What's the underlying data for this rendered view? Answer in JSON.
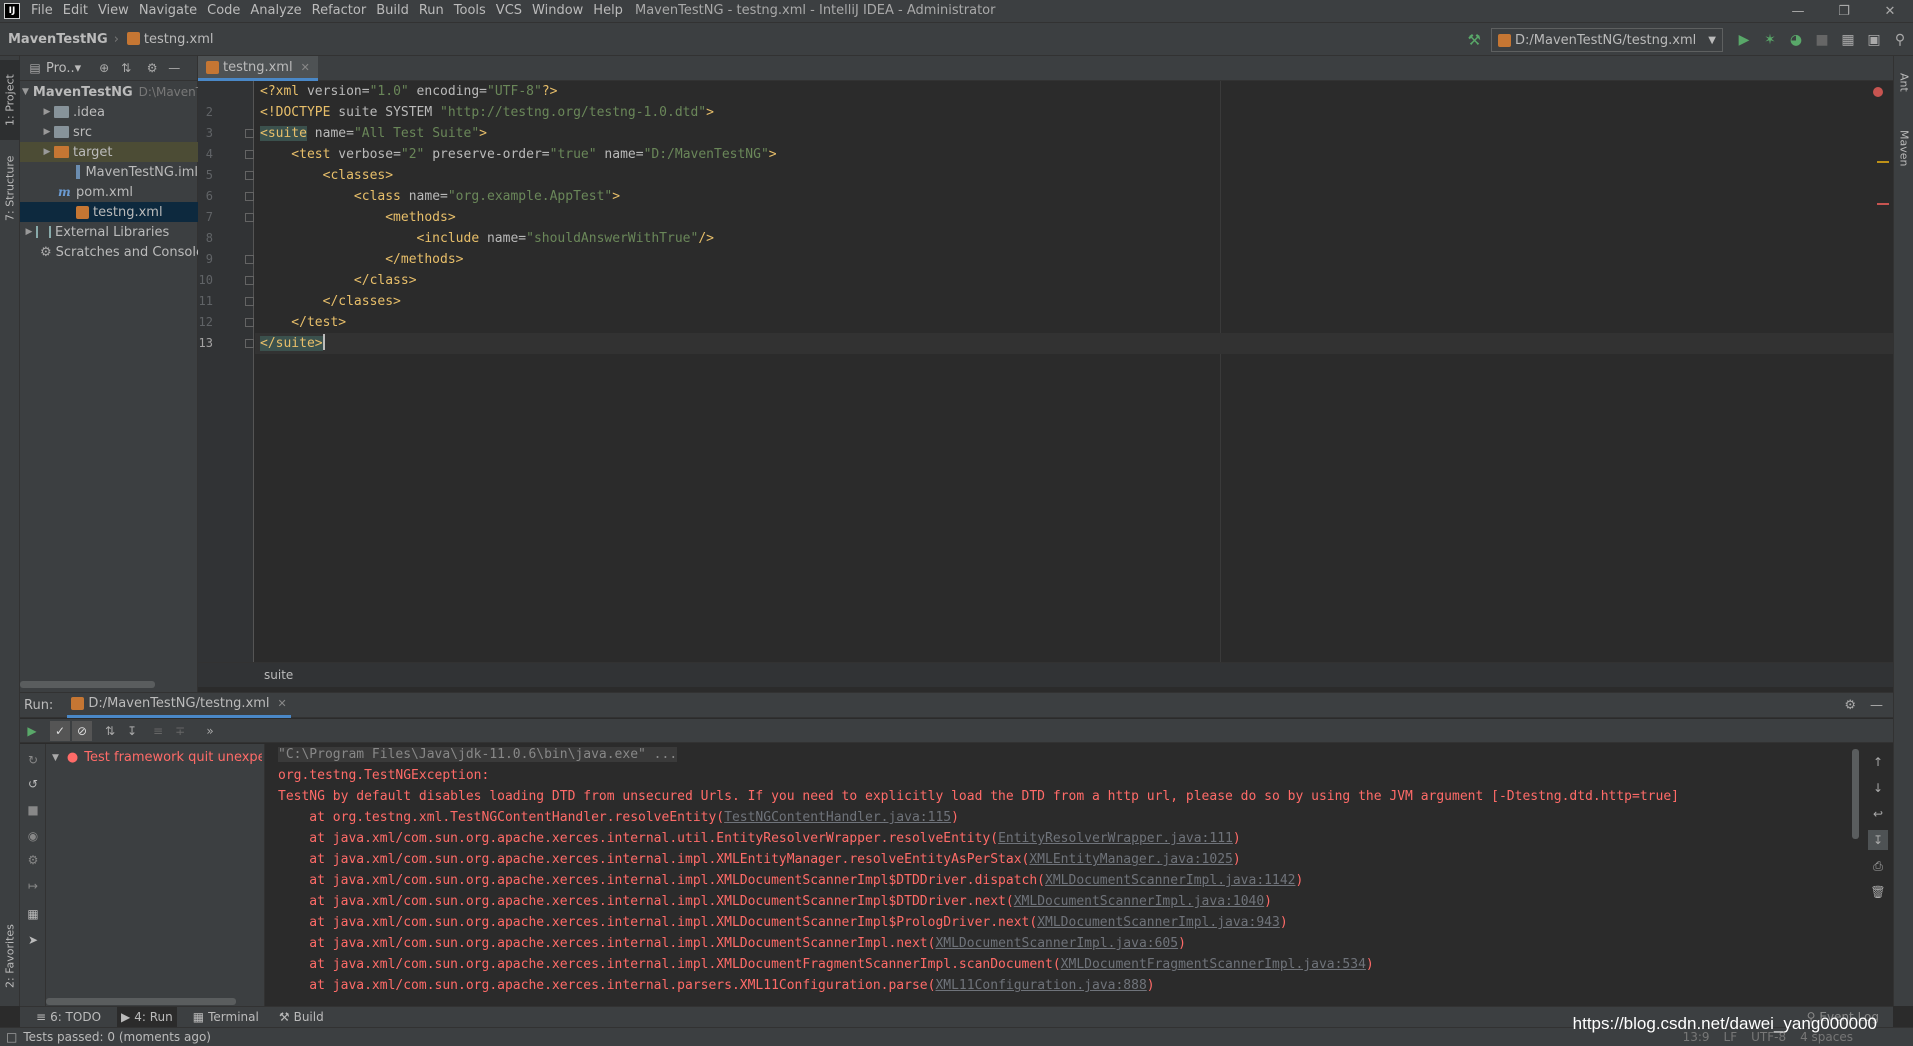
{
  "menubar": {
    "logo": "IJ",
    "items": [
      "File",
      "Edit",
      "View",
      "Navigate",
      "Code",
      "Analyze",
      "Refactor",
      "Build",
      "Run",
      "Tools",
      "VCS",
      "Window",
      "Help"
    ],
    "window_title": "MavenTestNG - testng.xml - IntelliJ IDEA - Administrator"
  },
  "navbar": {
    "project": "MavenTestNG",
    "file": "testng.xml",
    "run_config": "D:/MavenTestNG/testng.xml"
  },
  "left_stripe": {
    "project_tab": "1: Project",
    "structure_tab": "7: Structure",
    "favorites_tab": "2: Favorites"
  },
  "right_stripe": {
    "ant_tab": "Ant",
    "maven_tab": "Maven"
  },
  "project_panel": {
    "title": "Pro..▾",
    "tree": [
      {
        "label": "MavenTestNG",
        "hint": "D:\\MavenTestNG"
      },
      {
        "label": ".idea"
      },
      {
        "label": "src"
      },
      {
        "label": "target"
      },
      {
        "label": "MavenTestNG.iml"
      },
      {
        "label": "pom.xml"
      },
      {
        "label": "testng.xml"
      },
      {
        "label": "External Libraries"
      },
      {
        "label": "Scratches and Consoles"
      }
    ]
  },
  "editor": {
    "tab": "testng.xml",
    "breadcrumb": "suite",
    "line_numbers": [
      "2",
      "3",
      "4",
      "5",
      "6",
      "7",
      "8",
      "9",
      "10",
      "11",
      "12",
      "13"
    ],
    "lines": [
      {
        "tag": "<?xml",
        "a1": " version=",
        "v1": "\"1.0\"",
        "a2": " encoding=",
        "v2": "\"UTF-8\"",
        "end": "?>"
      },
      {
        "tag": "<!DOCTYPE",
        "a1": " suite SYSTEM ",
        "v1": "\"http://testng.org/testng-1.0.dtd\"",
        "end": ">"
      },
      {
        "tag": "suite",
        "a1": " name=",
        "v1": "\"All Test Suite\"",
        "end": ">"
      },
      {
        "tag": "    <test",
        "a1": " verbose=",
        "v1": "\"2\"",
        "a2": " preserve-order=",
        "v2": "\"true\"",
        "a3": " name=",
        "v3": "\"D:/MavenTestNG\"",
        "end": ">"
      },
      {
        "tag": "        <classes>"
      },
      {
        "tag": "            <class",
        "a1": " name=",
        "v1": "\"org.example.AppTest\"",
        "end": ">"
      },
      {
        "tag": "                <methods>"
      },
      {
        "tag": "                    <include",
        "a1": " name=",
        "v1": "\"shouldAnswerWithTrue\"",
        "end": "/>"
      },
      {
        "tag": "                </methods>"
      },
      {
        "tag": "            </class>"
      },
      {
        "tag": "        </classes>"
      },
      {
        "tag": "    </test>"
      },
      {
        "tag": "/suite"
      }
    ]
  },
  "run_panel": {
    "label": "Run:",
    "tab": "D:/MavenTestNG/testng.xml",
    "test_result": "Test framework quit unexpect",
    "console": {
      "cmd": "\"C:\\Program Files\\Java\\jdk-11.0.6\\bin\\java.exe\" ...",
      "exception": "org.testng.TestNGException:",
      "message": "TestNG by default disables loading DTD from unsecured Urls. If you need to explicitly load the DTD from a http url, please do so by using the JVM argument [-Dtestng.dtd.http=true]",
      "stack": [
        {
          "at": "    at org.testng.xml.TestNGContentHandler.resolveEntity(",
          "link": "TestNGContentHandler.java:115",
          "end": ")"
        },
        {
          "at": "    at java.xml/com.sun.org.apache.xerces.internal.util.EntityResolverWrapper.resolveEntity(",
          "link": "EntityResolverWrapper.java:111",
          "end": ")"
        },
        {
          "at": "    at java.xml/com.sun.org.apache.xerces.internal.impl.XMLEntityManager.resolveEntityAsPerStax(",
          "link": "XMLEntityManager.java:1025",
          "end": ")"
        },
        {
          "at": "    at java.xml/com.sun.org.apache.xerces.internal.impl.XMLDocumentScannerImpl$DTDDriver.dispatch(",
          "link": "XMLDocumentScannerImpl.java:1142",
          "end": ")"
        },
        {
          "at": "    at java.xml/com.sun.org.apache.xerces.internal.impl.XMLDocumentScannerImpl$DTDDriver.next(",
          "link": "XMLDocumentScannerImpl.java:1040",
          "end": ")"
        },
        {
          "at": "    at java.xml/com.sun.org.apache.xerces.internal.impl.XMLDocumentScannerImpl$PrologDriver.next(",
          "link": "XMLDocumentScannerImpl.java:943",
          "end": ")"
        },
        {
          "at": "    at java.xml/com.sun.org.apache.xerces.internal.impl.XMLDocumentScannerImpl.next(",
          "link": "XMLDocumentScannerImpl.java:605",
          "end": ")"
        },
        {
          "at": "    at java.xml/com.sun.org.apache.xerces.internal.impl.XMLDocumentFragmentScannerImpl.scanDocument(",
          "link": "XMLDocumentFragmentScannerImpl.java:534",
          "end": ")"
        },
        {
          "at": "    at java.xml/com.sun.org.apache.xerces.internal.parsers.XML11Configuration.parse(",
          "link": "XML11Configuration.java:888",
          "end": ")"
        }
      ]
    }
  },
  "bottom_bar": {
    "todo": "6: TODO",
    "run": "4: Run",
    "terminal": "Terminal",
    "build": "Build",
    "event_log": "Event Log"
  },
  "status_bar": {
    "message": "Tests passed: 0 (moments ago)",
    "position": "13:9",
    "line_sep": "LF",
    "encoding": "UTF-8",
    "indent": "4 spaces"
  },
  "watermark": "https://blog.csdn.net/dawei_yang000000",
  "colors": {
    "accent": "#4a88c7",
    "error": "#ff6b68",
    "tag": "#e8bf6a",
    "string": "#6a8759"
  }
}
